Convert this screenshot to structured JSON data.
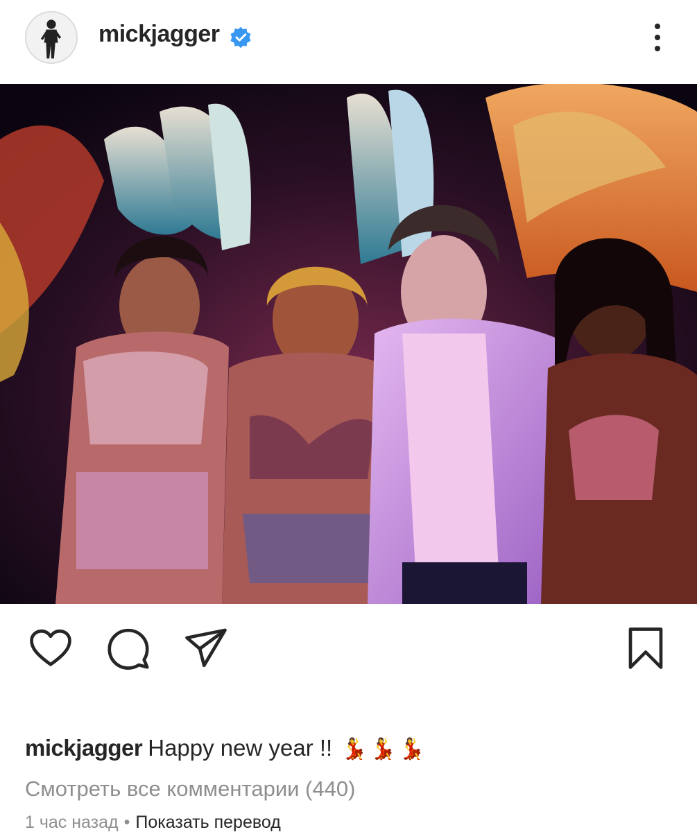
{
  "post": {
    "username": "mickjagger",
    "verified": true,
    "more_icon": "more-vertical-icon",
    "photo_alt": "Photo",
    "caption_text": "Happy new year !!",
    "caption_emojis": [
      "💃",
      "💃",
      "💃"
    ],
    "view_comments": "Смотреть все комментарии (440)",
    "time_ago": "1 час назад",
    "separator": "•",
    "translate_link": "Показать перевод"
  },
  "actions": {
    "like_icon": "heart-icon",
    "comment_icon": "comment-icon",
    "share_icon": "paper-plane-icon",
    "save_icon": "bookmark-icon"
  },
  "colors": {
    "text": "#262626",
    "secondary": "#8e8e8e",
    "verified_blue": "#3897f0"
  }
}
